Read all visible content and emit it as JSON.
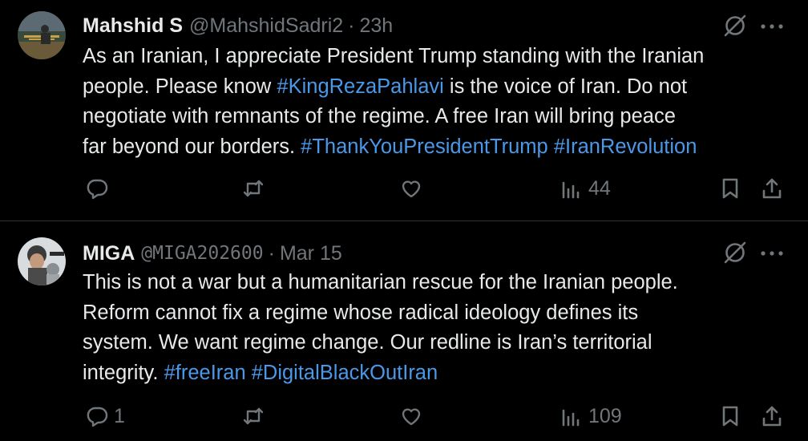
{
  "colors": {
    "background": "#000000",
    "text": "#e7e9ea",
    "muted": "#71767b",
    "link": "#4a99e9",
    "divider": "#2f3336"
  },
  "tweets": [
    {
      "name": "Mahshid S",
      "handle": "@MahshidSadri2",
      "separator": "·",
      "time": "23h",
      "lines": [
        [
          {
            "t": "As an Iranian, I appreciate President Trump standing with the Iranian"
          }
        ],
        [
          {
            "t": "people. Please know "
          },
          {
            "t": "#KingRezaPahlavi",
            "tag": true
          },
          {
            "t": " is the voice of Iran. Do not"
          }
        ],
        [
          {
            "t": "negotiate with remnants of the regime. A free Iran will bring peace"
          }
        ],
        [
          {
            "t": "far beyond our borders. "
          },
          {
            "t": "#ThankYouPresidentTrump",
            "tag": true
          },
          {
            "t": " "
          },
          {
            "t": "#IranRevolution",
            "tag": true
          }
        ]
      ],
      "reply_count": "",
      "views": "44",
      "icons": [
        "reply-icon",
        "retweet-icon",
        "like-icon",
        "views-icon",
        "bookmark-icon",
        "share-icon",
        "grok-icon",
        "more-icon"
      ]
    },
    {
      "name": "MIGA",
      "handle": "@MIGA202600",
      "separator": "·",
      "time": "Mar 15",
      "lines": [
        [
          {
            "t": "This is not a war but a humanitarian rescue for the Iranian people."
          }
        ],
        [
          {
            "t": "Reform cannot fix a regime whose radical ideology defines its"
          }
        ],
        [
          {
            "t": "system. We want regime change. Our redline is Iran’s territorial"
          }
        ],
        [
          {
            "t": "integrity. "
          },
          {
            "t": "#freeIran",
            "tag": true
          },
          {
            "t": " "
          },
          {
            "t": "#DigitalBlackOutIran",
            "tag": true
          }
        ]
      ],
      "reply_count": "1",
      "views": "109",
      "icons": [
        "reply-icon",
        "retweet-icon",
        "like-icon",
        "views-icon",
        "bookmark-icon",
        "share-icon",
        "grok-icon",
        "more-icon"
      ]
    }
  ]
}
